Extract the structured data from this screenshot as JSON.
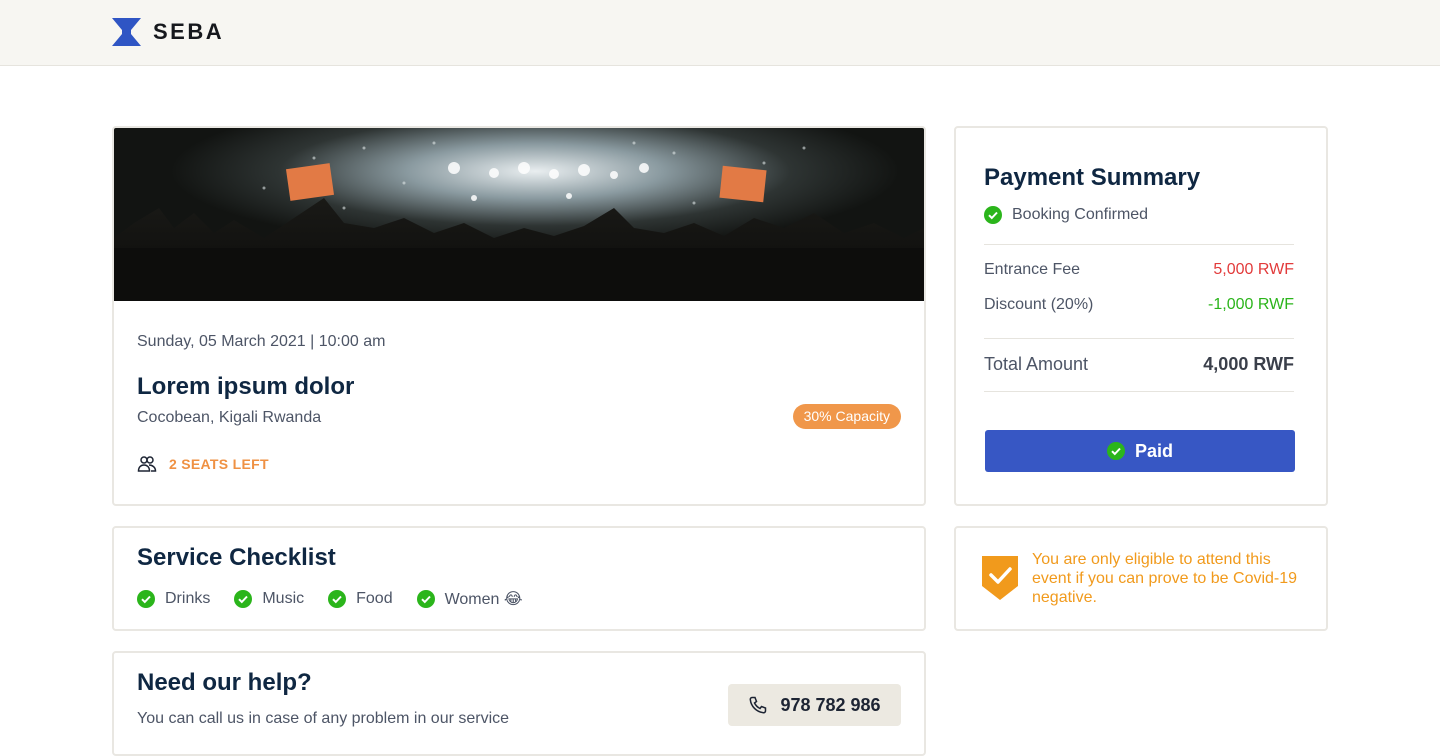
{
  "brand": {
    "name": "SEBA",
    "logo_color": "#2f55c4"
  },
  "event": {
    "date_time": "Sunday, 05 March 2021 | 10:00 am",
    "title": "Lorem ipsum dolor",
    "location": "Cocobean, Kigali Rwanda",
    "capacity_badge": "30% Capacity",
    "seats_left": "2 SEATS LEFT",
    "image_icon": "concert-photo"
  },
  "checklist": {
    "title": "Service Checklist",
    "items": [
      {
        "label": "Drinks"
      },
      {
        "label": "Music"
      },
      {
        "label": "Food"
      },
      {
        "label": "Women 😂"
      }
    ]
  },
  "help": {
    "title": "Need our help?",
    "subtitle": "You can call us in case of any problem in our service",
    "phone": "978 782 986",
    "icon": "phone-icon"
  },
  "payment": {
    "title": "Payment Summary",
    "status": "Booking Confirmed",
    "entrance_fee_label": "Entrance Fee",
    "entrance_fee_value": "5,000 RWF",
    "discount_label": "Discount (20%)",
    "discount_value": "-1,000 RWF",
    "total_label": "Total Amount",
    "total_value": "4,000 RWF",
    "button_label": "Paid"
  },
  "covid": {
    "message": "You are only eligible to attend this event if you can prove to be Covid-19 negative.",
    "icon": "shield-check-icon"
  },
  "colors": {
    "accent_blue": "#3757c4",
    "orange": "#f0974a",
    "success": "#2bb51b",
    "danger": "#e23b3b",
    "warning": "#f19a1c"
  }
}
